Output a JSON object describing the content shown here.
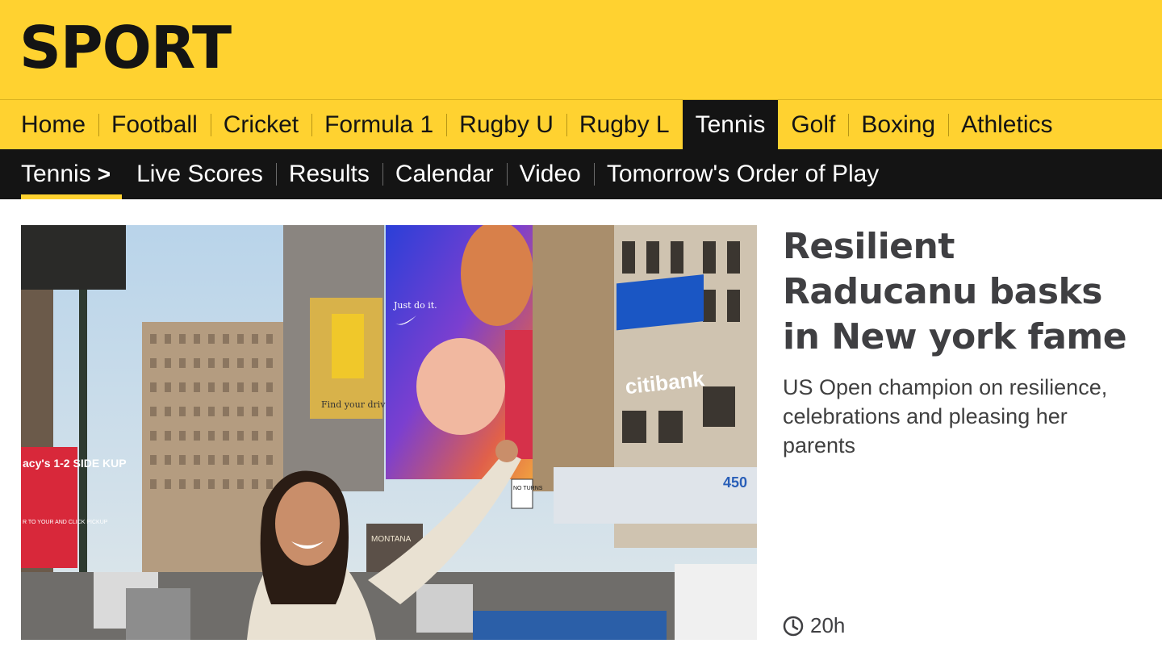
{
  "brand": {
    "title": "SPORT",
    "color": "#ffd230"
  },
  "primary_nav": {
    "items": [
      {
        "label": "Home"
      },
      {
        "label": "Football"
      },
      {
        "label": "Cricket"
      },
      {
        "label": "Formula 1"
      },
      {
        "label": "Rugby U"
      },
      {
        "label": "Rugby L"
      },
      {
        "label": "Tennis",
        "active": true
      },
      {
        "label": "Golf"
      },
      {
        "label": "Boxing"
      },
      {
        "label": "Athletics"
      }
    ]
  },
  "secondary_nav": {
    "section": "Tennis",
    "items": [
      {
        "label": "Live Scores"
      },
      {
        "label": "Results"
      },
      {
        "label": "Calendar"
      },
      {
        "label": "Video"
      },
      {
        "label": "Tomorrow's Order of Play"
      }
    ]
  },
  "story": {
    "headline": "Resilient Raducanu basks in New york fame",
    "summary": "US Open champion on resilience, celebrations and pleasing her parents",
    "timestamp": "20h",
    "image_signage": {
      "billboard_slogan": "Just do it.",
      "poster_text": "Find your drive",
      "bank_sign": "citibank",
      "store_sign": "acy's 1-2 SIDE KUP",
      "store_sign_small": "R TO YOUR AND CLICK PICKUP",
      "building_number": "450",
      "theatre_sign": "MONTANA",
      "street_sign": "NO TURNS"
    }
  }
}
